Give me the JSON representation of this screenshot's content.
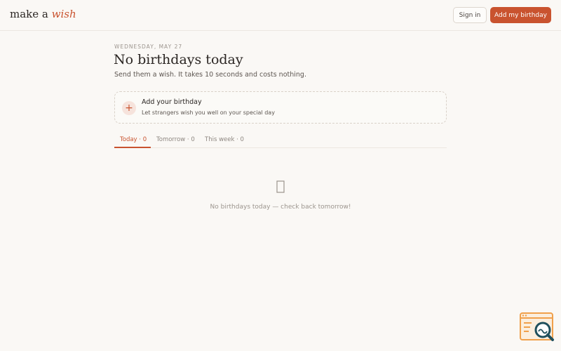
{
  "header": {
    "logo_main": "make a",
    "logo_accent": "wish",
    "signin_label": "Sign in",
    "add_label": "Add my birthday"
  },
  "main": {
    "date": "WEDNESDAY, MAY 27",
    "title": "No birthdays today",
    "subtitle": "Send them a wish. It takes 10 seconds and costs nothing.",
    "card": {
      "icon": "plus-icon",
      "title": "Add your birthday",
      "subtitle": "Let strangers wish you well on your special day"
    },
    "tabs": [
      {
        "label": "Today · 0",
        "active": true
      },
      {
        "label": "Tomorrow · 0",
        "active": false
      },
      {
        "label": "This week · 0",
        "active": false
      }
    ],
    "empty": {
      "icon": "gift-icon",
      "text": "No birthdays today — check back tomorrow!"
    }
  },
  "colors": {
    "accent": "#c9532f",
    "background": "#faf8f5"
  }
}
